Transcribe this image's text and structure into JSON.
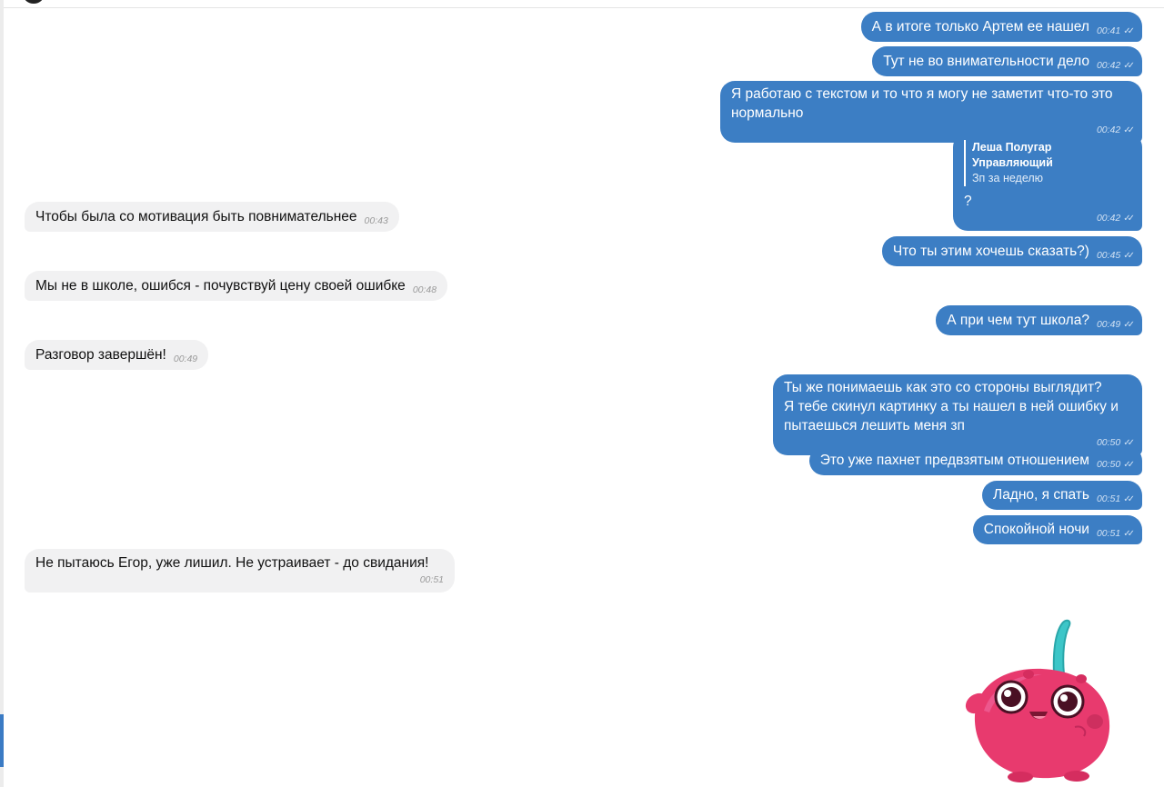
{
  "messages": [
    {
      "text": "А в итоге только Артем ее нашел",
      "time": "00:41"
    },
    {
      "text": "Тут не во внимательности дело",
      "time": "00:42"
    },
    {
      "text": "Я работаю с текстом и то что я могу не заметит что-то это\nнормально",
      "time": "00:42"
    },
    {
      "reply_author": "Леша Полугар Управляющий",
      "reply_text": "Зп за неделю",
      "text": "?",
      "time": "00:42"
    },
    {
      "text": "Чтобы была со мотивация быть повнимательнее",
      "time": "00:43"
    },
    {
      "text": "Что ты этим хочешь сказать?)",
      "time": "00:45"
    },
    {
      "text": "Мы не в школе, ошибся - почувствуй цену своей ошибке",
      "time": "00:48"
    },
    {
      "text": "А при чем тут школа?",
      "time": "00:49"
    },
    {
      "text": "Разговор завершён!",
      "time": "00:49"
    },
    {
      "text": "Ты же понимаешь как это со стороны выглядит?\nЯ тебе скинул картинку а ты нашел в ней ошибку и\nпытаешься лешить меня зп",
      "time": "00:50"
    },
    {
      "text": "Это уже пахнет предвзятым отношением",
      "time": "00:50"
    },
    {
      "text": "Ладно, я спать",
      "time": "00:51"
    },
    {
      "text": "Спокойной ночи",
      "time": "00:51"
    },
    {
      "text": "Не пытаюсь Егор, уже лишил. Не устраивает - до свидания!",
      "time": "00:51"
    }
  ],
  "icons": {
    "read_receipt": "double-check-icon",
    "sticker": "cherry-sticker-icon"
  },
  "colors": {
    "outgoing_bubble": "#3c7ec4",
    "incoming_bubble": "#f1f1f2",
    "sticker_body": "#e83a6e",
    "sticker_stem": "#3cc6c8"
  }
}
